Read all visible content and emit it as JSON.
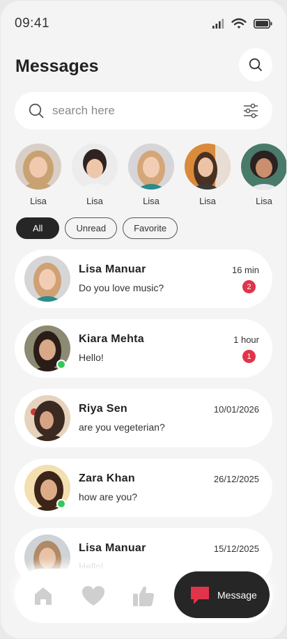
{
  "status_bar": {
    "time": "09:41"
  },
  "header": {
    "title": "Messages"
  },
  "search": {
    "placeholder": "search here"
  },
  "stories": [
    {
      "name": "Lisa"
    },
    {
      "name": "Lisa"
    },
    {
      "name": "Lisa"
    },
    {
      "name": "Lisa"
    },
    {
      "name": "Lisa"
    }
  ],
  "filters": {
    "all": "All",
    "unread": "Unread",
    "favorite": "Favorite"
  },
  "conversations": [
    {
      "name": "Lisa Manuar",
      "preview": "Do you love music?",
      "time": "16 min",
      "unread": "2"
    },
    {
      "name": "Kiara Mehta",
      "preview": "Hello!",
      "time": "1 hour",
      "unread": "1"
    },
    {
      "name": "Riya Sen",
      "preview": "are you vegeterian?",
      "time": "10/01/2026"
    },
    {
      "name": "Zara Khan",
      "preview": "how are you?",
      "time": "26/12/2025"
    },
    {
      "name": "Lisa Manuar",
      "preview": "Hello!",
      "time": "15/12/2025"
    }
  ],
  "bottom_nav": {
    "message_label": "Message"
  },
  "colors": {
    "accent": "#e0344a",
    "dark": "#262626",
    "online": "#34c759"
  },
  "icons": [
    "signal-icon",
    "wifi-icon",
    "battery-icon",
    "search-icon",
    "filter-icon",
    "home-icon",
    "heart-icon",
    "thumbs-up-icon",
    "message-icon"
  ]
}
